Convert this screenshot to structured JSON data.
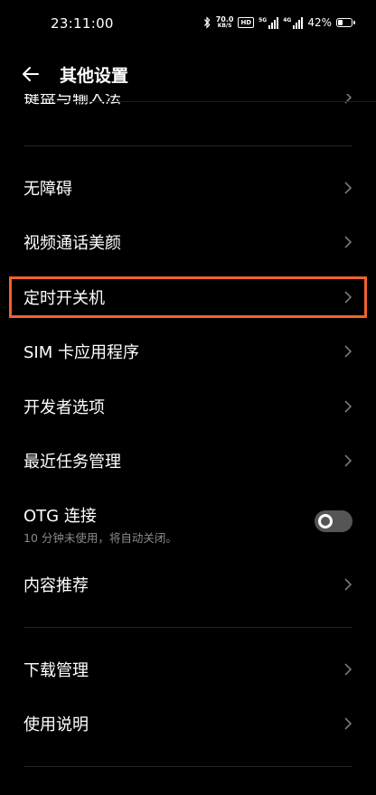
{
  "status_bar": {
    "time": "23:11:00",
    "net_speed_value": "70.0",
    "net_speed_unit": "KB/S",
    "hd_badge": "HD",
    "sim1_tag": "5G",
    "sim2_tag": "4G",
    "battery_percent": "42%",
    "battery_level": 0.42
  },
  "header": {
    "title": "其他设置"
  },
  "cut_item": {
    "label": "键盘与输入法"
  },
  "items": [
    {
      "label": "无障碍"
    },
    {
      "label": "视频通话美颜"
    },
    {
      "label": "定时开关机"
    },
    {
      "label": "SIM 卡应用程序"
    },
    {
      "label": "开发者选项"
    },
    {
      "label": "最近任务管理"
    }
  ],
  "otg": {
    "label": "OTG 连接",
    "sublabel": "10 分钟未使用，将自动关闭。",
    "enabled": false
  },
  "items2": [
    {
      "label": "内容推荐"
    }
  ],
  "items3": [
    {
      "label": "下载管理"
    },
    {
      "label": "使用说明"
    }
  ],
  "highlight_color": "#f2622e"
}
